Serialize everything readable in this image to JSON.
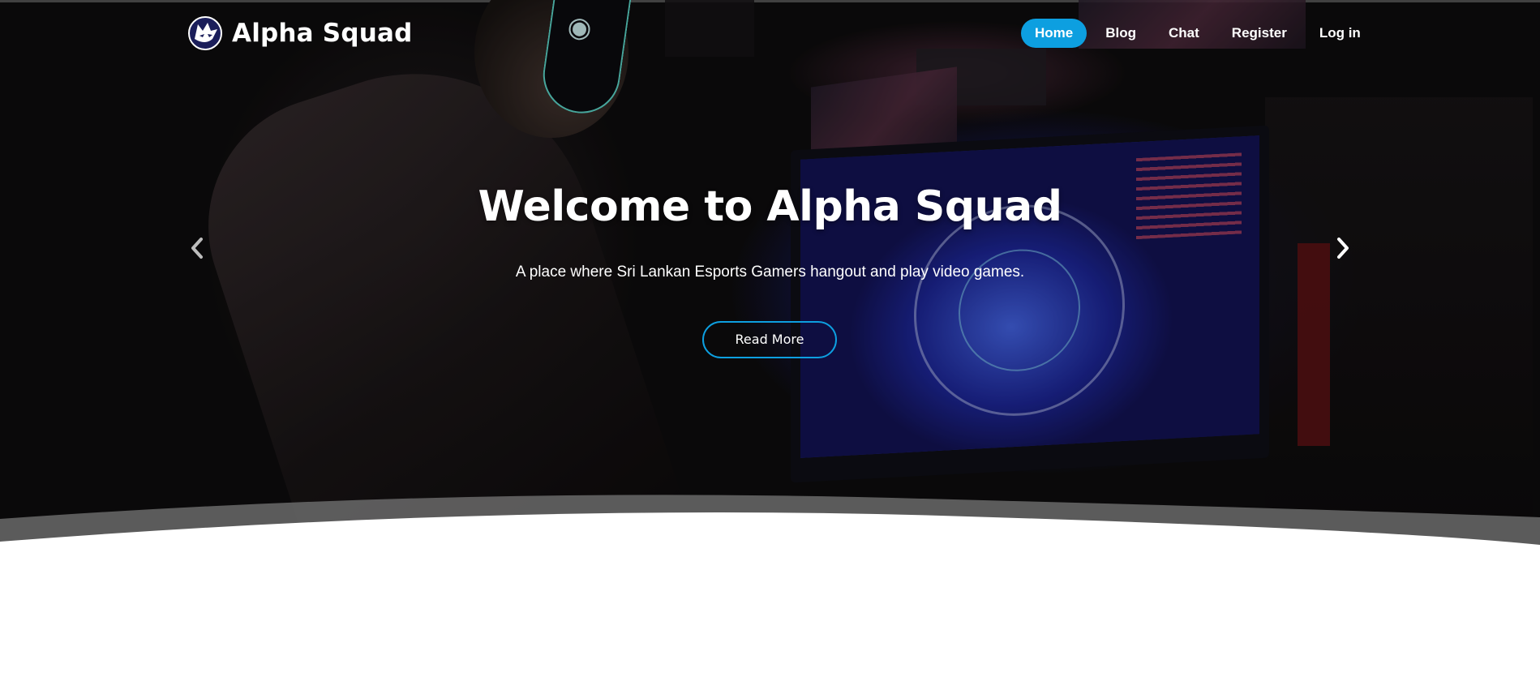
{
  "brand": {
    "name": "Alpha Squad",
    "logo_icon": "wolf-logo-icon"
  },
  "nav": {
    "items": [
      {
        "label": "Home",
        "active": true
      },
      {
        "label": "Blog",
        "active": false
      },
      {
        "label": "Chat",
        "active": false
      },
      {
        "label": "Register",
        "active": false
      },
      {
        "label": "Log in",
        "active": false
      }
    ]
  },
  "hero": {
    "title": "Welcome to Alpha Squad",
    "subtitle": "A place where Sri Lankan Esports Gamers hangout and play video games.",
    "cta_label": "Read More",
    "prev_icon": "chevron-left-icon",
    "next_icon": "chevron-right-icon"
  },
  "colors": {
    "accent": "#0d9fe0",
    "text_on_dark": "#ffffff",
    "page_background": "#ffffff"
  }
}
